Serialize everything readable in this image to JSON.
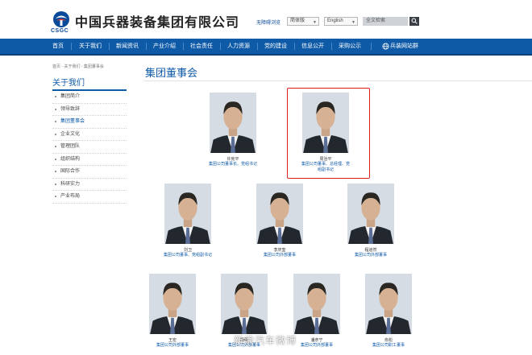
{
  "header": {
    "company_name": "中国兵器装备集团有限公司",
    "logo_abbr": "CSGC",
    "region_label": "无障碍浏览",
    "lang_select_1": "简体版",
    "lang_select_2": "English",
    "search_placeholder": "全文检索"
  },
  "nav": {
    "items": [
      "首页",
      "关于我们",
      "新闻资讯",
      "产业介绍",
      "社会责任",
      "人力资源",
      "党的建设",
      "信息公开",
      "采购公示",
      "兵装网站群"
    ]
  },
  "sidebar": {
    "breadcrumb": "首页 - 关于我们 - 集团董事会",
    "title": "关于我们",
    "items": [
      "集团简介",
      "领导致辞",
      "集团董事会",
      "企业文化",
      "管理团队",
      "组织结构",
      "国际合作",
      "科研实力",
      "产业布局"
    ],
    "active_index": 2
  },
  "main": {
    "page_title": "集团董事会",
    "members": [
      {
        "name": "许宪平",
        "role": "集团公司董事长、党组书记"
      },
      {
        "name": "周治平",
        "role": "集团公司董事、总经理、党组副书记"
      },
      {
        "name": "刘卫",
        "role": "集团公司董事、党组副书记"
      },
      {
        "name": "李庆奎",
        "role": "集团公司外部董事"
      },
      {
        "name": "程道然",
        "role": "集团公司外部董事"
      },
      {
        "name": "王宏",
        "role": "集团公司外部董事"
      },
      {
        "name": "杨明",
        "role": "集团公司外部董事"
      },
      {
        "name": "潘彦宁",
        "role": "集团公司外部董事"
      },
      {
        "name": "俞松",
        "role": "集团公司职工董事"
      }
    ]
  },
  "watermark": "新浪汽车微博",
  "colors": {
    "brand_blue": "#0e5aa7",
    "highlight_red": "#e02020"
  }
}
